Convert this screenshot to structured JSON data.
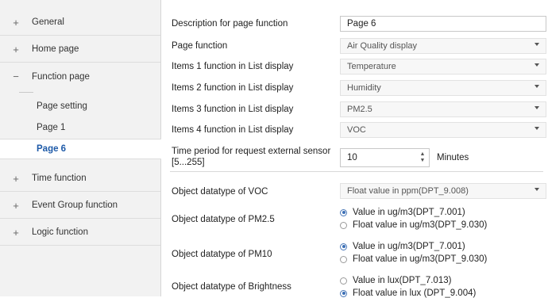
{
  "sidebar": {
    "items": [
      {
        "symbol": "+",
        "label": "General"
      },
      {
        "symbol": "+",
        "label": "Home page"
      },
      {
        "symbol": "−",
        "label": "Function page"
      }
    ],
    "subitems": [
      {
        "label": "Page setting"
      },
      {
        "label": "Page 1"
      },
      {
        "label": "Page 6"
      }
    ],
    "items_after": [
      {
        "symbol": "+",
        "label": "Time function"
      },
      {
        "symbol": "+",
        "label": "Event Group function"
      },
      {
        "symbol": "+",
        "label": "Logic function"
      }
    ]
  },
  "main": {
    "description": {
      "label": "Description for page function",
      "value": "Page 6"
    },
    "page_function": {
      "label": "Page function",
      "value": "Air Quality display"
    },
    "items": [
      {
        "label": "Items 1 function in List display",
        "value": "Temperature"
      },
      {
        "label": "Items 2 function in List display",
        "value": "Humidity"
      },
      {
        "label": "Items 3 function in List display",
        "value": "PM2.5"
      },
      {
        "label": "Items 4 function in List display",
        "value": "VOC"
      }
    ],
    "time_period": {
      "label_line1": "Time period for request external sensor",
      "label_line2": "[5...255]",
      "value": "10",
      "unit": "Minutes"
    },
    "voc": {
      "label": "Object datatype of VOC",
      "value": "Float value in ppm(DPT_9.008)"
    },
    "pm25": {
      "label": "Object datatype of PM2.5",
      "options": [
        "Value in ug/m3(DPT_7.001)",
        "Float value in ug/m3(DPT_9.030)"
      ],
      "selected": 0
    },
    "pm10": {
      "label": "Object datatype of PM10",
      "options": [
        "Value in ug/m3(DPT_7.001)",
        "Float value in ug/m3(DPT_9.030)"
      ],
      "selected": 0
    },
    "brightness": {
      "label": "Object datatype of Brightness",
      "options": [
        "Value in lux(DPT_7.013)",
        "Float value in lux (DPT_9.004)"
      ],
      "selected": 1
    }
  }
}
